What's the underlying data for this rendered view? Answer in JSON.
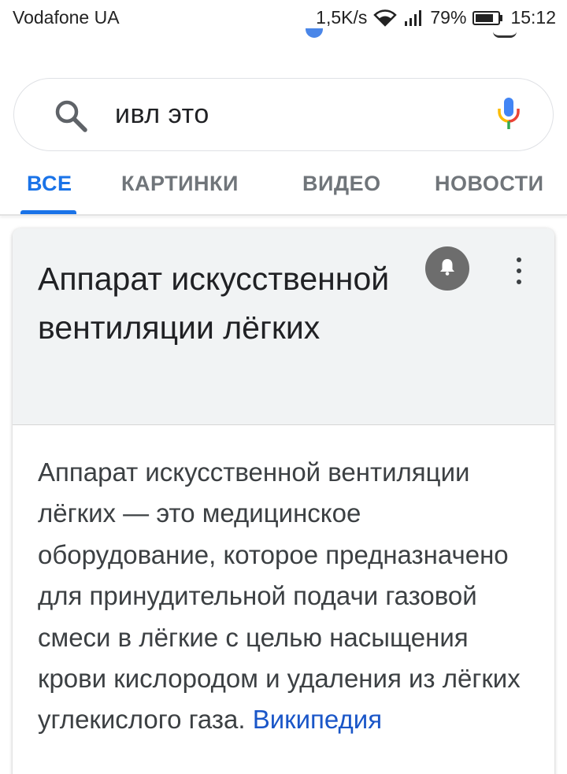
{
  "status_bar": {
    "carrier": "Vodafone UA",
    "speed": "1,5K/s",
    "battery": "79%",
    "time": "15:12",
    "icons": [
      "wifi-icon",
      "signal-icon",
      "battery-icon"
    ]
  },
  "search": {
    "query": "ивл это",
    "icons": [
      "search-icon",
      "mic-icon"
    ]
  },
  "tabs": [
    {
      "label": "ВСЕ",
      "active": true
    },
    {
      "label": "КАРТИНКИ",
      "active": false
    },
    {
      "label": "ВИДЕО",
      "active": false
    },
    {
      "label": "НОВОСТИ",
      "active": false
    }
  ],
  "knowledge_card": {
    "title": "Аппарат искусственной вентиляции лёгких",
    "description": "Аппарат искусственной вентиляции лёгких — это медицинское оборудование, которое предназначено для принудительной подачи газовой смеси в лёгкие с целью насыщения крови кислородом и удаления из лёгких углекислого газа.",
    "source_link": "Википедия",
    "icons": [
      "bell-icon",
      "more-vert-icon"
    ]
  },
  "colors": {
    "accent": "#1a73e8",
    "link": "#1a56c8",
    "tab_inactive": "#70757a",
    "card_header_bg": "#f1f3f4"
  }
}
